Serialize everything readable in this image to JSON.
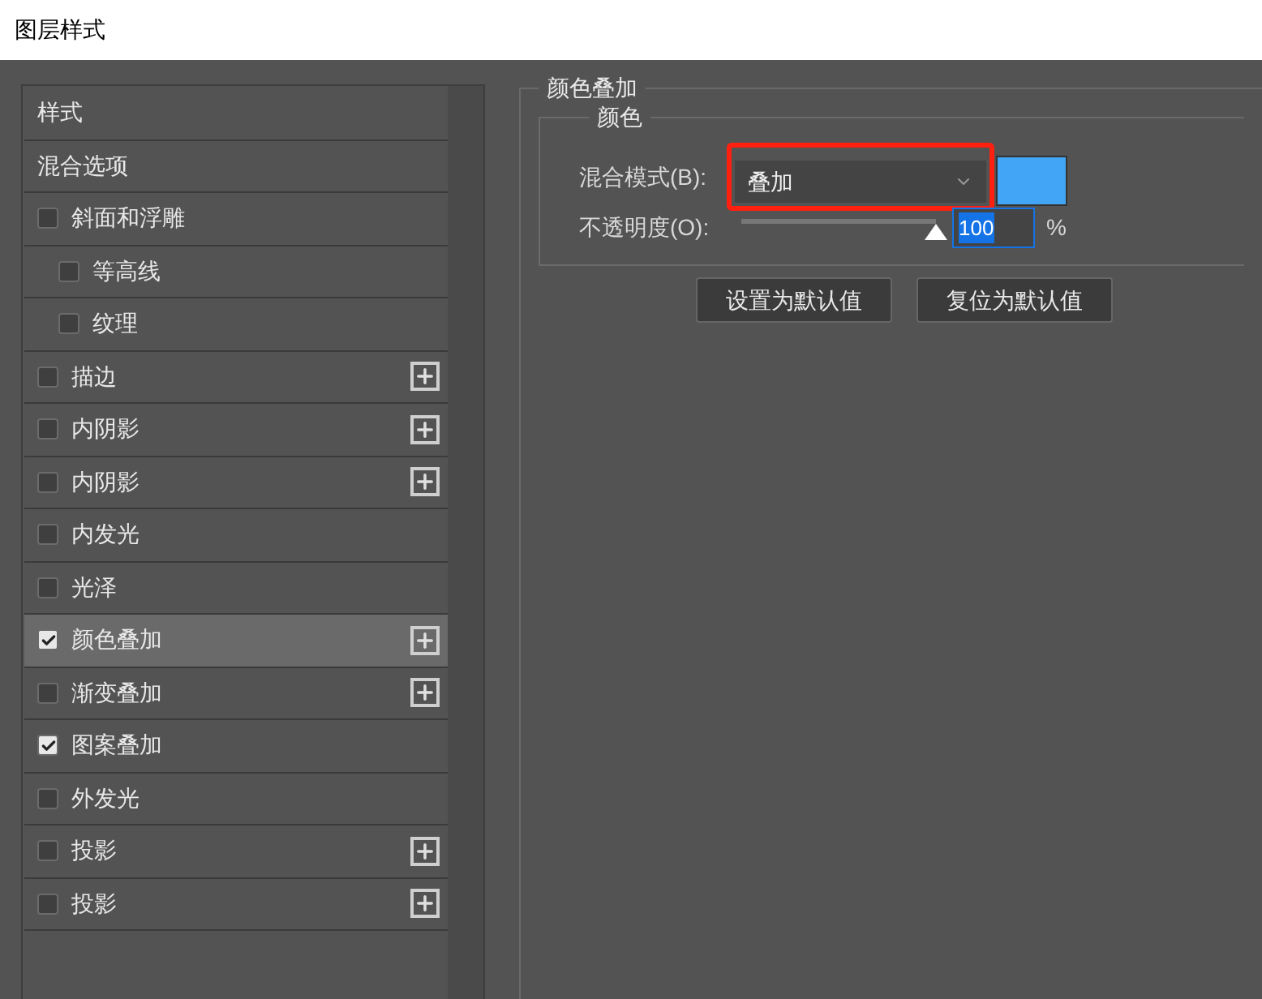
{
  "window": {
    "title": "图层样式"
  },
  "styles_list": [
    {
      "label": "样式",
      "kind": "header",
      "selected": false
    },
    {
      "label": "混合选项",
      "kind": "header",
      "selected": false
    },
    {
      "label": "斜面和浮雕",
      "kind": "checkbox",
      "checked": false,
      "selected": false,
      "add_button": false,
      "children": [
        {
          "label": "等高线",
          "kind": "checkbox",
          "checked": false,
          "selected": false,
          "add_button": false
        },
        {
          "label": "纹理",
          "kind": "checkbox",
          "checked": false,
          "selected": false,
          "add_button": false
        }
      ]
    },
    {
      "label": "描边",
      "kind": "checkbox",
      "checked": false,
      "selected": false,
      "add_button": true
    },
    {
      "label": "内阴影",
      "kind": "checkbox",
      "checked": false,
      "selected": false,
      "add_button": true
    },
    {
      "label": "内阴影",
      "kind": "checkbox",
      "checked": false,
      "selected": false,
      "add_button": true
    },
    {
      "label": "内发光",
      "kind": "checkbox",
      "checked": false,
      "selected": false,
      "add_button": false
    },
    {
      "label": "光泽",
      "kind": "checkbox",
      "checked": false,
      "selected": false,
      "add_button": false
    },
    {
      "label": "颜色叠加",
      "kind": "checkbox",
      "checked": true,
      "selected": true,
      "add_button": true
    },
    {
      "label": "渐变叠加",
      "kind": "checkbox",
      "checked": false,
      "selected": false,
      "add_button": true
    },
    {
      "label": "图案叠加",
      "kind": "checkbox",
      "checked": true,
      "selected": false,
      "add_button": false
    },
    {
      "label": "外发光",
      "kind": "checkbox",
      "checked": false,
      "selected": false,
      "add_button": false
    },
    {
      "label": "投影",
      "kind": "checkbox",
      "checked": false,
      "selected": false,
      "add_button": true
    },
    {
      "label": "投影",
      "kind": "checkbox",
      "checked": false,
      "selected": false,
      "add_button": true
    }
  ],
  "panel": {
    "title": "颜色叠加",
    "group": {
      "title": "颜色",
      "blend_mode": {
        "label": "混合模式(B):",
        "value": "叠加",
        "highlighted": true,
        "color": "#42a5f5"
      },
      "opacity": {
        "label": "不透明度(O):",
        "level": 1,
        "value": "100",
        "unit": "%"
      }
    },
    "buttons": [
      "设置为默认值",
      "复位为默认值"
    ]
  }
}
